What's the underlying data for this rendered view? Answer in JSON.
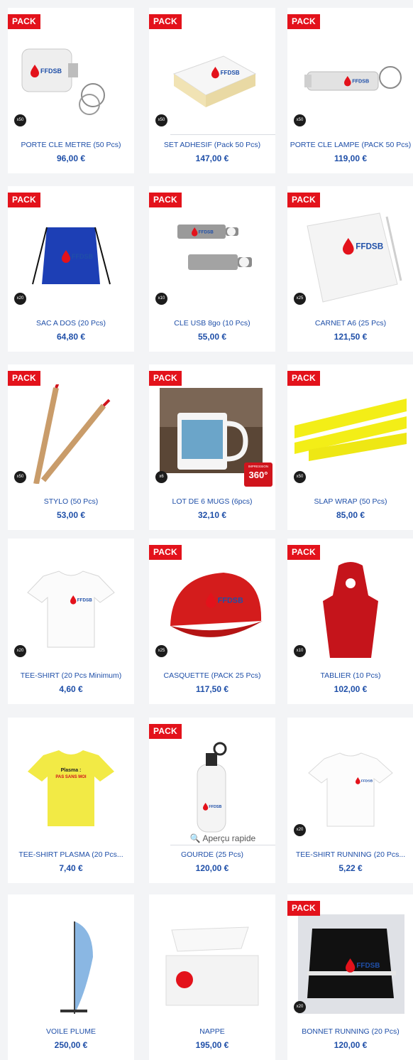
{
  "colors": {
    "pack": "#e3121b",
    "text": "#1f4fa8",
    "qty_badge": "#1c1c1c"
  },
  "pack_label": "PACK",
  "quick_view_label": "Aperçu rapide",
  "mug_badge": {
    "top": "IMPRESSION",
    "value": "360°"
  },
  "products": [
    {
      "name": "PORTE CLE METRE (50 Pcs)",
      "price": "96,00 €",
      "qty": "x50",
      "pack": true,
      "image": "keychain-tape"
    },
    {
      "name": "SET ADHESIF (Pack 50 Pcs)",
      "price": "147,00 €",
      "qty": "x50",
      "pack": true,
      "image": "sticky-notes"
    },
    {
      "name": "PORTE CLE LAMPE (PACK 50 Pcs)",
      "price": "119,00 €",
      "qty": "x50",
      "pack": true,
      "image": "keychain-lamp"
    },
    {
      "name": "SAC A DOS (20 Pcs)",
      "price": "64,80 €",
      "qty": "x20",
      "pack": true,
      "image": "drawstring-bag"
    },
    {
      "name": "CLE USB 8go (10 Pcs)",
      "price": "55,00 €",
      "qty": "x10",
      "pack": true,
      "image": "usb-keys"
    },
    {
      "name": "CARNET A6 (25 Pcs)",
      "price": "121,50 €",
      "qty": "x25",
      "pack": true,
      "image": "notebook"
    },
    {
      "name": "STYLO (50 Pcs)",
      "price": "53,00 €",
      "qty": "x50",
      "pack": true,
      "image": "pens"
    },
    {
      "name": "LOT DE 6 MUGS (6pcs)",
      "price": "32,10 €",
      "qty": "x6",
      "pack": true,
      "image": "mug"
    },
    {
      "name": "SLAP WRAP (50 Pcs)",
      "price": "85,00 €",
      "qty": "x50",
      "pack": true,
      "image": "slap-wrap"
    },
    {
      "name": "TEE-SHIRT (20 Pcs Minimum)",
      "price": "4,60 €",
      "qty": "x20",
      "pack": false,
      "image": "tshirt-white"
    },
    {
      "name": "CASQUETTE (PACK 25 Pcs)",
      "price": "117,50 €",
      "qty": "x25",
      "pack": true,
      "image": "cap"
    },
    {
      "name": "TABLIER (10 Pcs)",
      "price": "102,00 €",
      "qty": "x10",
      "pack": true,
      "image": "apron"
    },
    {
      "name": "TEE-SHIRT PLASMA (20 Pcs...",
      "price": "7,40 €",
      "qty": "",
      "pack": false,
      "image": "tshirt-yellow"
    },
    {
      "name": "GOURDE (25 Pcs)",
      "price": "120,00 €",
      "qty": "",
      "pack": true,
      "image": "bottle"
    },
    {
      "name": "TEE-SHIRT RUNNING (20 Pcs...",
      "price": "5,22 €",
      "qty": "x20",
      "pack": false,
      "image": "tshirt-running"
    },
    {
      "name": "VOILE PLUME",
      "price": "250,00 €",
      "qty": "",
      "pack": false,
      "image": "feather-flag"
    },
    {
      "name": "NAPPE",
      "price": "195,00 €",
      "qty": "",
      "pack": false,
      "image": "tablecloth"
    },
    {
      "name": "BONNET RUNNING (20 Pcs)",
      "price": "120,00 €",
      "qty": "x20",
      "pack": true,
      "image": "beanie-bag"
    }
  ],
  "image_text": {
    "logo": "FFDSB",
    "plasma_line1": "Plasma :",
    "plasma_line2": "PAS SANS MOI"
  }
}
